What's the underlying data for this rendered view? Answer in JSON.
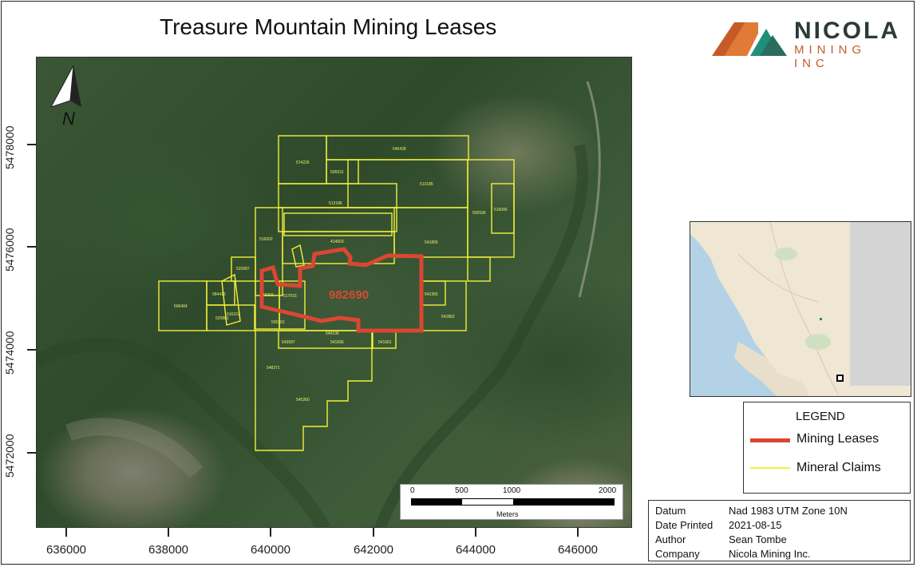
{
  "title": "Treasure Mountain Mining Leases",
  "logo": {
    "name": "NICOLA",
    "subtitle": "MINING INC"
  },
  "north_arrow": {
    "label": "N"
  },
  "axes": {
    "y_ticks": [
      "5478000",
      "5476000",
      "5474000",
      "5472000"
    ],
    "x_ticks": [
      "636000",
      "638000",
      "640000",
      "642000",
      "644000",
      "646000"
    ]
  },
  "lease": {
    "label": "982690",
    "color": "#d94733"
  },
  "claims": {
    "color": "#f2f03a",
    "labels": [
      "574226",
      "546428",
      "505531",
      "513185",
      "513186",
      "505536",
      "516006",
      "516002",
      "414603",
      "541865",
      "520987",
      "506404",
      "584412",
      "545002",
      "517015",
      "541365",
      "520881",
      "516101",
      "505301",
      "541862",
      "549106",
      "543697",
      "541696",
      "541661",
      "548371",
      "545260"
    ]
  },
  "scalebar": {
    "ticks": [
      "0",
      "500",
      "1000",
      "2000"
    ],
    "units": "Meters"
  },
  "legend": {
    "title": "LEGEND",
    "items": [
      {
        "label": "Mining Leases",
        "color": "#d94733"
      },
      {
        "label": "Mineral Claims",
        "color": "#f2f03a"
      }
    ]
  },
  "info": [
    {
      "key": "Datum",
      "value": "Nad 1983 UTM Zone 10N"
    },
    {
      "key": "Date Printed",
      "value": "2021-08-15"
    },
    {
      "key": "Author",
      "value": "Sean Tombe"
    },
    {
      "key": "Company",
      "value": "Nicola Mining Inc."
    }
  ]
}
